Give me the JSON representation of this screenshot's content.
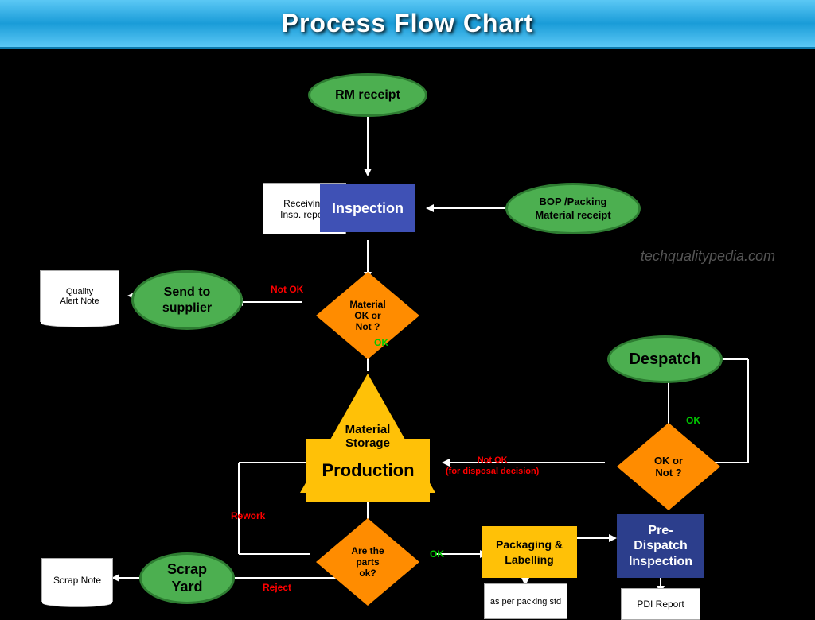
{
  "header": {
    "title": "Process Flow Chart"
  },
  "nodes": {
    "rm_receipt": "RM receipt",
    "bop_packing": "BOP /Packing\nMaterial receipt",
    "inspection": "Inspection",
    "receiving_report": "Receiving\nInsp. report",
    "material_ok": "Material\nOK or\nNot ?",
    "send_supplier": "Send to\nsupplier",
    "quality_alert": "Quality\nAlert Note",
    "material_storage": "Material\nStorage",
    "production": "Production",
    "are_parts_ok": "Are the\nparts\nok?",
    "packaging": "Packaging &\nLabelling",
    "packing_std": "as per\npacking std",
    "pre_dispatch": "Pre-\nDispatch\nInspection",
    "pdi_report": "PDI Report",
    "despatch": "Despatch",
    "ok_or_not": "OK or\nNot ?",
    "scrap_yard": "Scrap\nYard",
    "scrap_note": "Scrap Note"
  },
  "labels": {
    "not_ok1": "Not OK",
    "ok1": "OK",
    "not_ok2": "Not OK\n(for disposal decision)",
    "ok2": "OK",
    "rework": "Rework",
    "ok3": "OK",
    "reject": "Reject"
  },
  "watermark": "techqualitypedia.com"
}
